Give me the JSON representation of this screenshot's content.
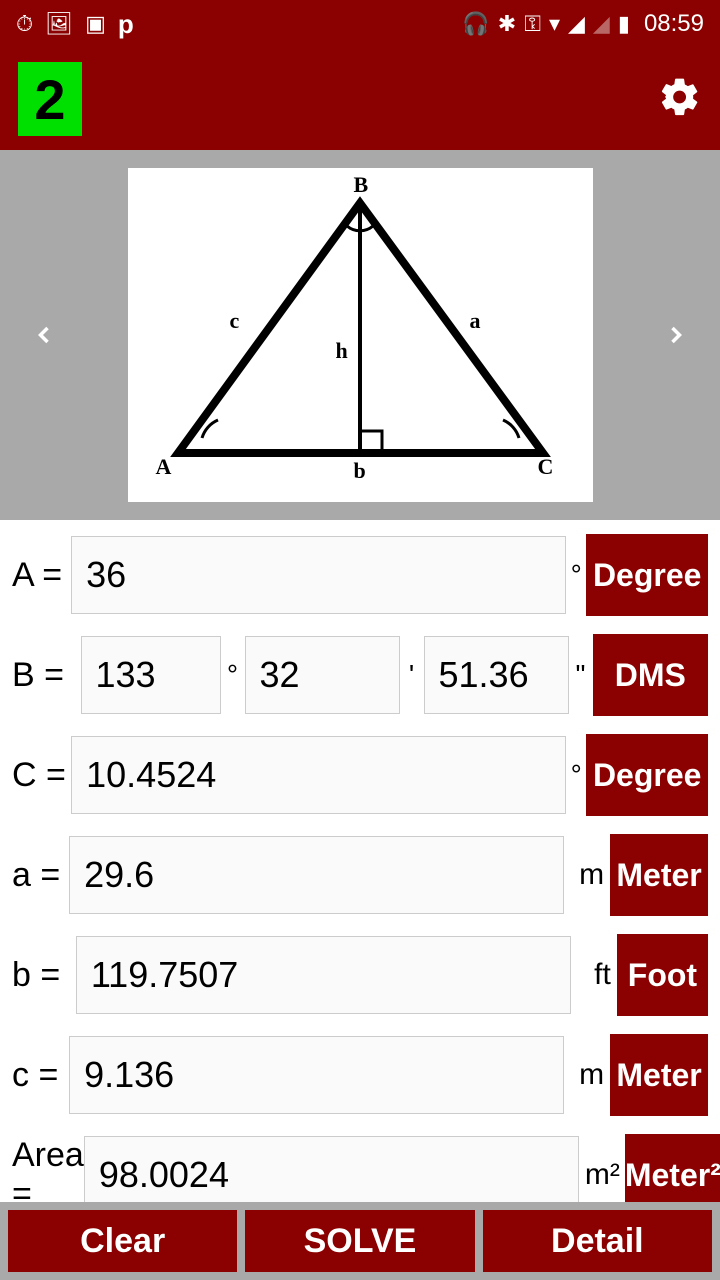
{
  "status": {
    "time": "08:59"
  },
  "header": {
    "badge": "2"
  },
  "diagram": {
    "B": "B",
    "A": "A",
    "C": "C",
    "a": "a",
    "b": "b",
    "c": "c",
    "h": "h"
  },
  "rows": {
    "A": {
      "label": "A = ",
      "value": "36",
      "sym": "°",
      "unit": "Degree"
    },
    "B": {
      "label": "B = ",
      "d": "133",
      "m": "32",
      "s": "51.36",
      "dsym": "°",
      "msym": "'",
      "ssym": "\"",
      "unit": "DMS"
    },
    "C": {
      "label": "C = ",
      "value": "10.4524",
      "sym": "°",
      "unit": "Degree"
    },
    "a": {
      "label": "a = ",
      "value": "29.6",
      "usym": "m",
      "unit": "Meter"
    },
    "b": {
      "label": "b = ",
      "value": "119.7507",
      "usym": "ft",
      "unit": "Foot"
    },
    "c": {
      "label": "c = ",
      "value": "9.136",
      "usym": "m",
      "unit": "Meter"
    },
    "area": {
      "label": "Area = ",
      "value": "98.0024",
      "usym": "m²",
      "unit": "Meter²"
    }
  },
  "buttons": {
    "clear": "Clear",
    "solve": "SOLVE",
    "detail": "Detail"
  }
}
